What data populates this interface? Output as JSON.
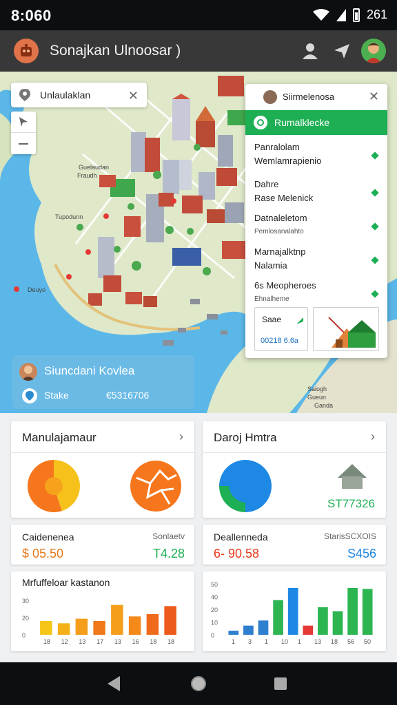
{
  "status_bar": {
    "time": "8:060",
    "right_text": "261"
  },
  "header": {
    "title": "Sonajkan Ulnoosar )",
    "colors": {
      "bar": "#383838",
      "logo": "#e0734a",
      "avatar": "#4caf50"
    }
  },
  "map": {
    "search_text": "Unlaulaklan",
    "labels": [
      "Guelaudan",
      "Fraudh",
      "Tupodunn",
      "Deuyo",
      "Saiogh",
      "Gueun",
      "Ganda"
    ],
    "user_card": {
      "name": "Siuncdani Kovlea",
      "location_label": "Stake",
      "location_value": "€5316706"
    }
  },
  "info_panel": {
    "title": "Siirmelenosa",
    "banner": "Rumalklecke",
    "rows": [
      {
        "line1": "Panralolam",
        "line2": "Wemlamrapienio",
        "small": false
      },
      {
        "line1": "Dahre",
        "line2": "Rase Melenick",
        "small": false
      },
      {
        "line1": "Datnaleletom",
        "line2": "Pemlosanalahto",
        "small": true
      },
      {
        "line1": "Marnajalktnp",
        "line2": "Nalamia",
        "small": false
      },
      {
        "line1": "6s Meopheroes",
        "line2": "Ehnalheme",
        "small": true
      }
    ],
    "mini_left": {
      "title": "Saae",
      "value": "00218 6.6a"
    }
  },
  "cards": {
    "card1": {
      "title": "Manulajamaur"
    },
    "card2": {
      "title": "Daroj Hmtra",
      "value": "ST77326"
    },
    "stat1": {
      "label": "Caidenenea",
      "sub": "Sonlaetv",
      "value": "$ 05.50",
      "value2": "T4.28"
    },
    "stat2": {
      "label": "Deallenneda",
      "sub": "StarisSCXOIS",
      "value": "6- 90.58",
      "value2": "S456"
    },
    "chart1_title": "Mrfuffeloar kastanon"
  },
  "chart_data": [
    {
      "type": "bar",
      "title": "Mrfuffeloar kastanon",
      "categories": [
        "18",
        "12",
        "13",
        "17",
        "13",
        "16",
        "18",
        "18"
      ],
      "yticks": [
        "30",
        "20",
        "0"
      ],
      "values": [
        12,
        10,
        14,
        12,
        26,
        16,
        18,
        25
      ],
      "ylim": [
        0,
        30
      ],
      "colors": [
        "#f5c518",
        "#f5b019",
        "#f59e1c",
        "#f07a1a",
        "#f59e1c",
        "#f5891a",
        "#f06a1c",
        "#ee5a1c"
      ]
    },
    {
      "type": "bar",
      "categories": [
        "1",
        "3",
        "1",
        "10",
        "1",
        "13",
        "18",
        "56",
        "50"
      ],
      "yticks": [
        "50",
        "40",
        "20",
        "10",
        "0"
      ],
      "values": [
        4,
        9,
        14,
        34,
        46,
        9,
        27,
        23,
        46,
        45
      ],
      "ylim": [
        0,
        50
      ],
      "colors": [
        "#2f7fd0",
        "#2f7fd0",
        "#2f7fd0",
        "#2db552",
        "#1e88e5",
        "#e53935",
        "#2db552",
        "#2db552",
        "#2db552",
        "#2db552"
      ]
    }
  ],
  "pies": {
    "pie1": {
      "type": "pie",
      "values": [
        45,
        55
      ],
      "colors": [
        "#f7c11c",
        "#f5761c"
      ]
    },
    "pie3": {
      "type": "pie",
      "values": [
        75,
        25
      ],
      "colors": [
        "#1e88e5",
        "#1eaf55"
      ]
    }
  }
}
